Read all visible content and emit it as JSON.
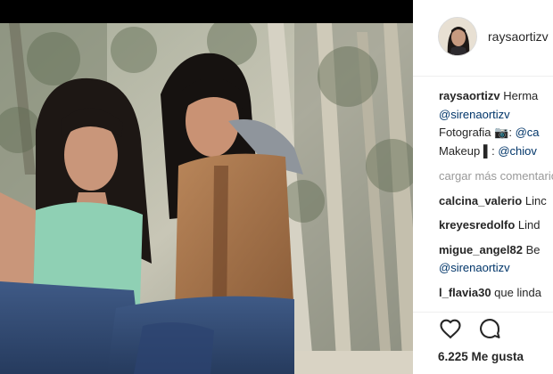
{
  "post": {
    "author": "raysaortizv",
    "caption_text": "Herma",
    "caption_mention": "@sirenaortizv",
    "photo_label": "Fotografia",
    "photo_mention": "@ca",
    "makeup_label": "Makeup",
    "makeup_mention": "@chiov"
  },
  "comments": {
    "load_more": "cargar más comentarios",
    "items": [
      {
        "user": "calcina_valerio",
        "text": "Linc",
        "mention": ""
      },
      {
        "user": "kreyesredolfo",
        "text": "Lind",
        "mention": ""
      },
      {
        "user": "migue_angel82",
        "text": "Be",
        "mention": "@sirenaortizv"
      },
      {
        "user": "l_flavia30",
        "text": "que linda",
        "mention": ""
      }
    ]
  },
  "actions": {
    "like_icon": "heart-icon",
    "comment_icon": "speech-bubble-icon",
    "likes_count": "6.225 Me gusta"
  },
  "colors": {
    "mention": "#003569",
    "muted": "#999999",
    "text": "#262626",
    "divider": "#efefef"
  }
}
